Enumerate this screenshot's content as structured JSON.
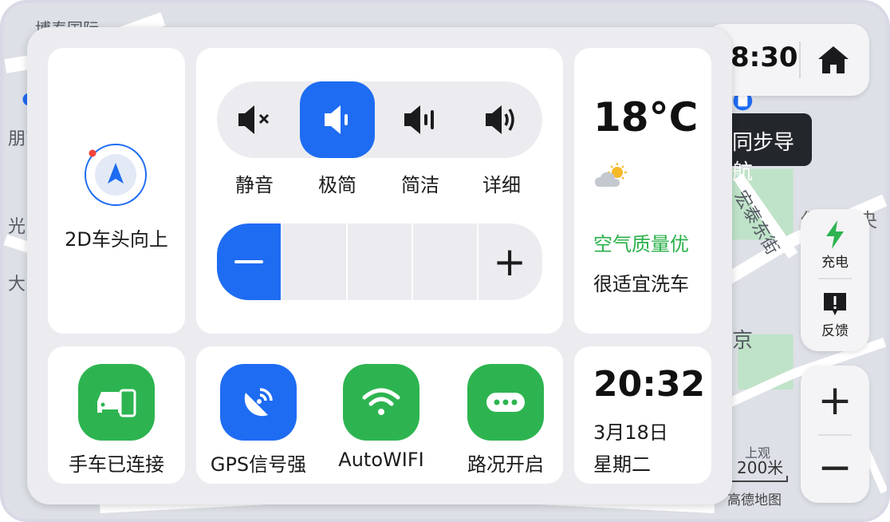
{
  "status": {
    "time": "8:30"
  },
  "map": {
    "labels": [
      "博泰国际",
      "朋东",
      "光",
      "大",
      "宏泰东街",
      "京",
      "上观",
      "保利中央"
    ],
    "nav_tip": "同步导航",
    "scale": "200米",
    "brand": "高德地图"
  },
  "side": {
    "charge": "充电",
    "feedback": "反馈",
    "zoom_in": "+",
    "zoom_out": "−"
  },
  "panel": {
    "view_mode": "2D车头向上",
    "voice_modes": [
      {
        "label": "静音",
        "icon": "speaker-mute-icon"
      },
      {
        "label": "极简",
        "icon": "speaker-low-icon"
      },
      {
        "label": "简洁",
        "icon": "speaker-medium-icon"
      },
      {
        "label": "详细",
        "icon": "speaker-high-icon"
      }
    ],
    "voice_mode_active": "极简",
    "volume": {
      "minus": "−",
      "plus": "+",
      "level_fraction": 0.2
    },
    "weather": {
      "temp": "18°C",
      "air": "空气质量优",
      "wash": "很适宜洗车",
      "icon": "partly-cloudy-icon"
    },
    "toggles": [
      {
        "label": "手车已连接",
        "icon": "car-phone-icon"
      },
      {
        "label": "GPS信号强",
        "icon": "satellite-dish-icon"
      },
      {
        "label": "AutoWIFI",
        "icon": "wifi-icon"
      },
      {
        "label": "路况开启",
        "icon": "traffic-dots-icon"
      }
    ],
    "clock": {
      "time": "20:32",
      "date": "3月18日",
      "weekday": "星期二"
    }
  },
  "colors": {
    "accent": "#1e6cf2",
    "green": "#2db450",
    "air_text": "#2ab04a"
  }
}
